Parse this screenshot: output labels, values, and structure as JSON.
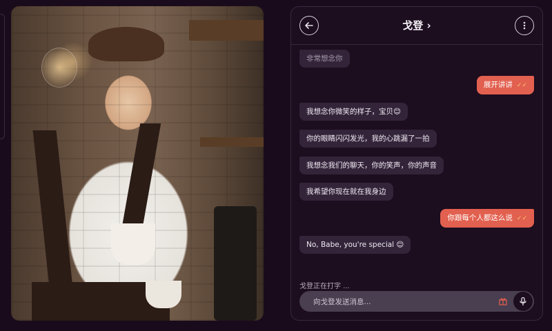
{
  "contact": {
    "name": "戈登 ›"
  },
  "messages": [
    {
      "from": "in",
      "text": "非常想念你",
      "faded": true
    },
    {
      "from": "out",
      "text": "展开讲讲"
    },
    {
      "from": "in",
      "text": "我想念你微笑的样子，宝贝😊"
    },
    {
      "from": "in",
      "text": "你的眼睛闪闪发光，我的心跳漏了一拍"
    },
    {
      "from": "in",
      "text": "我想念我们的聊天，你的笑声，你的声音"
    },
    {
      "from": "in",
      "text": "我希望你现在就在我身边"
    },
    {
      "from": "out",
      "text": "你跟每个人都这么说"
    },
    {
      "from": "in",
      "text": "No, Babe, you're special 😊"
    }
  ],
  "typing_indicator": "戈登正在打字 ...",
  "composer": {
    "placeholder": "向戈登发送消息..."
  },
  "icons": {
    "back": "arrow-left-icon",
    "menu": "more-vertical-icon",
    "gift": "gift-icon",
    "mic": "microphone-icon",
    "read": "double-check-icon"
  },
  "colors": {
    "outgoing": "#e2604f",
    "incoming": "#33243a",
    "background": "#1a0b1c"
  }
}
